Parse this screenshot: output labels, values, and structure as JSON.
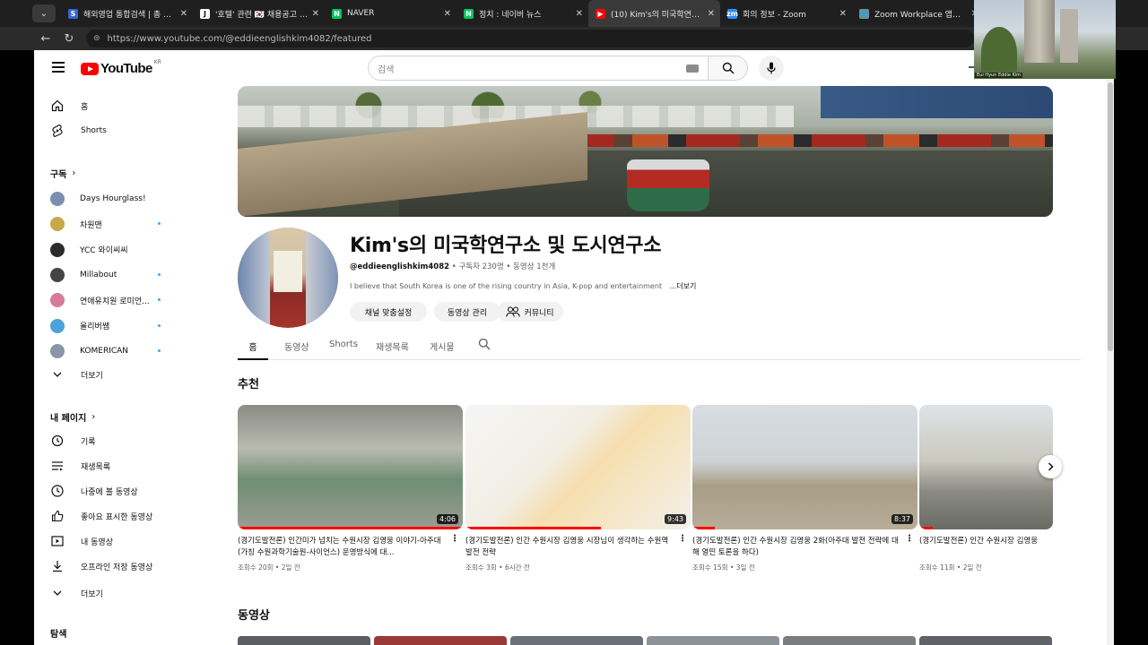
{
  "browser": {
    "tabs": [
      {
        "title": "해외영업 통합검색 | 총 9,09",
        "favicon": "S",
        "favicon_color": "#3367d6",
        "active": false
      },
      {
        "title": "'호텔' 관련 🇰🇷 채용공고 | 총",
        "favicon": "J",
        "favicon_color": "#ffffff",
        "active": false
      },
      {
        "title": "NAVER",
        "favicon": "N",
        "favicon_color": "#03c75a",
        "active": false
      },
      {
        "title": "정치 : 네이버 뉴스",
        "favicon": "N",
        "favicon_color": "#03c75a",
        "active": false
      },
      {
        "title": "(10) Kim's의 미국학연구소 및",
        "favicon": "▶",
        "favicon_color": "#ff0000",
        "active": true
      },
      {
        "title": "회의 정보 - Zoom",
        "favicon": "zm",
        "favicon_color": "#2d8cff",
        "active": false
      },
      {
        "title": "Zoom Workplace 앱에서 참",
        "favicon": "🌐",
        "favicon_color": "#888888",
        "active": false
      }
    ],
    "url": "https://www.youtube.com/@eddieenglishkim4082/featured"
  },
  "zoom": {
    "participant_name": "Eui Hyun Eddie Kim"
  },
  "masthead": {
    "logo_text": "YouTube",
    "country_code": "KR",
    "search_placeholder": "검색"
  },
  "sidebar": {
    "main": [
      {
        "label": "홈",
        "icon": "home-icon"
      },
      {
        "label": "Shorts",
        "icon": "shorts-icon"
      }
    ],
    "subscriptions_header": "구독",
    "subscriptions": [
      {
        "label": "Days Hourglass!",
        "color": "#7b8fb0",
        "new": false
      },
      {
        "label": "차원맨",
        "color": "#c9a84a",
        "new": true
      },
      {
        "label": "YCC 와이씨씨",
        "color": "#2b2b2b",
        "new": false
      },
      {
        "label": "Millabout",
        "color": "#444444",
        "new": true
      },
      {
        "label": "연애유치원 로미언...",
        "color": "#d77a9b",
        "new": true
      },
      {
        "label": "올리버쌤",
        "color": "#4ba3d9",
        "new": true
      },
      {
        "label": "KOMERICAN",
        "color": "#8a95a8",
        "new": true
      }
    ],
    "show_more": "더보기",
    "you_header": "내 페이지",
    "you_items": [
      {
        "label": "기록",
        "icon": "history-icon"
      },
      {
        "label": "재생목록",
        "icon": "playlist-icon"
      },
      {
        "label": "나중에 볼 동영상",
        "icon": "watch-later-icon"
      },
      {
        "label": "좋아요 표시한 동영상",
        "icon": "like-icon"
      },
      {
        "label": "내 동영상",
        "icon": "my-videos-icon"
      },
      {
        "label": "오프라인 저장 동영상",
        "icon": "download-icon"
      }
    ],
    "show_more_2": "더보기",
    "explore_header": "탐색"
  },
  "channel": {
    "name": "Kim's의 미국학연구소 및 도시연구소",
    "handle": "@eddieenglishkim4082",
    "subscribers": "구독자 230명",
    "video_count": "동영상 1천개",
    "description": "I believe that South Korea is one of the rising country in Asia, K-pop and entertainment",
    "more": "...더보기",
    "buttons": {
      "customize": "채널 맞춤설정",
      "manage": "동영상 관리",
      "community": "커뮤니티"
    }
  },
  "tabs": [
    {
      "label": "홈",
      "active": true
    },
    {
      "label": "동영상",
      "active": false
    },
    {
      "label": "Shorts",
      "active": false
    },
    {
      "label": "재생목록",
      "active": false
    },
    {
      "label": "게시물",
      "active": false
    }
  ],
  "sections": {
    "featured": "추천",
    "videos": "동영상"
  },
  "videos": [
    {
      "title": "(경기도발전론) 인간미가 넘치는 수원시장 김영웅 이야기-아주대(가칭 수원과학기술원-사이언스) 운영방식에 대...",
      "meta": "조회수 20회 • 2일 전",
      "duration": "4:06",
      "progress": 1.0
    },
    {
      "title": "(경기도발전론) 인간 수원시장 김영웅 시장님이 생각하는 수원역 발전 전략",
      "meta": "조회수 3회 • 6시간 전",
      "duration": "9:43",
      "progress": 0.6
    },
    {
      "title": "(경기도발전론) 인간 수원시장 김영웅 2화(아주대 발전 전략에 대해 열띤 토론을 하다)",
      "meta": "조회수 15회 • 3일 전",
      "duration": "8:37",
      "progress": 0.1
    },
    {
      "title": "(경기도발전론) 인간 수원시장 김영웅",
      "meta": "조회수 11회 • 2일 전",
      "duration": "",
      "progress": 0.1
    }
  ]
}
